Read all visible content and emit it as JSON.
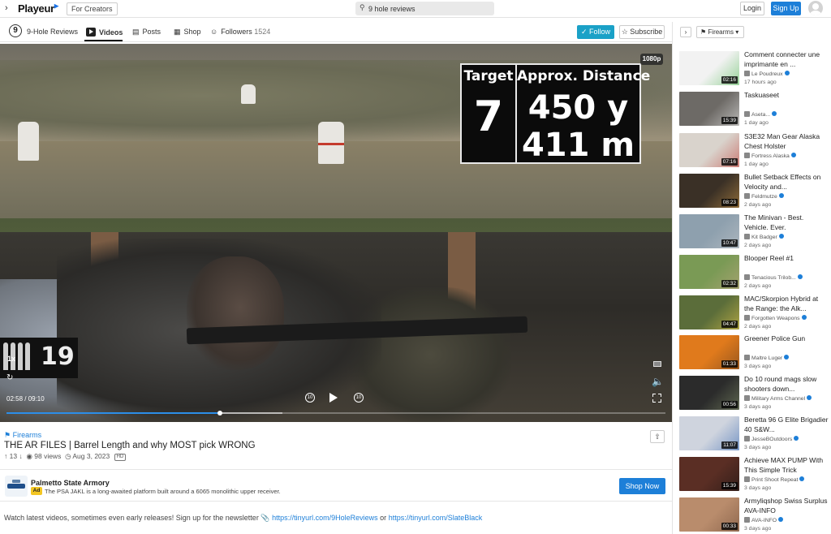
{
  "topbar": {
    "logo": "Playeur",
    "for_creators": "For Creators",
    "search_value": "9 hole reviews",
    "login": "Login",
    "signup": "Sign Up"
  },
  "channel": {
    "badge": "9",
    "name": "9-Hole Reviews",
    "tabs": [
      {
        "label": "Videos",
        "active": true
      },
      {
        "label": "Posts"
      },
      {
        "label": "Shop"
      },
      {
        "label": "Followers",
        "count": "1524"
      }
    ],
    "follow": "Follow",
    "subscribe": "Subscribe"
  },
  "player": {
    "quality": "1080p",
    "overlay": {
      "target_label": "Target",
      "target_value": "7",
      "distance_label": "Approx. Distance",
      "distance_yards": "450 y",
      "distance_meters": "411 m"
    },
    "ammo_count": "19",
    "speed": "1x",
    "time": "02:58 / 09:10",
    "rewind_label": "10",
    "forward_label": "10",
    "progress_fraction": 0.3236
  },
  "video": {
    "category": "Firearms",
    "title": "THE AR FILES | Barrel Length and why MOST pick WRONG",
    "votes": "13",
    "views": "98 views",
    "date": "Aug 3, 2023",
    "hd_badge": "HD"
  },
  "ad": {
    "advertiser": "Palmetto State Armory",
    "tag": "Ad",
    "text": "The PSA JAKL is a long-awaited platform built around a 6065 monolithic upper receiver.",
    "cta": "Shop Now"
  },
  "description": {
    "text": "Watch latest videos, sometimes even early releases! Sign up for the newsletter",
    "link1": "https://tinyurl.com/9HoleReviews",
    "or": "or",
    "link2": "https://tinyurl.com/SlateBlack"
  },
  "sidebar": {
    "filter": "Firearms",
    "videos": [
      {
        "title": "Comment connecter une imprimante en ...",
        "channel": "Le Poudreux",
        "age": "17 hours ago",
        "duration": "02:16",
        "thumb_color": "#f2f2f2",
        "thumb_accent": "#46b649"
      },
      {
        "title": "Taskuaseet",
        "channel": "Aseta...",
        "age": "1 day ago",
        "duration": "15:39",
        "thumb_color": "#6d6a66",
        "thumb_accent": "#ffffff"
      },
      {
        "title": "S3E32 Man Gear Alaska Chest Holster",
        "channel": "Fortress Alaska",
        "age": "1 day ago",
        "duration": "07:16",
        "thumb_color": "#d9d3cc",
        "thumb_accent": "#c0302a"
      },
      {
        "title": "Bullet Setback Effects on Velocity and...",
        "channel": "Feldmutze",
        "age": "2 days ago",
        "duration": "08:23",
        "thumb_color": "#3a3026",
        "thumb_accent": "#d9a04a"
      },
      {
        "title": "The Minivan - Best. Vehicle. Ever.",
        "channel": "Kit Badger",
        "age": "2 days ago",
        "duration": "10:47",
        "thumb_color": "#8ea0ae",
        "thumb_accent": "#c7c9cc"
      },
      {
        "title": "Blooper Reel #1",
        "channel": "Tenacious Trilob...",
        "age": "2 days ago",
        "duration": "02:32",
        "thumb_color": "#7a9a55",
        "thumb_accent": "#c9a986"
      },
      {
        "title": "MAC/Skorpion Hybrid at the Range: the Alk...",
        "channel": "Forgotten Weapons",
        "age": "2 days ago",
        "duration": "04:47",
        "thumb_color": "#5b6d3a",
        "thumb_accent": "#f6d34a"
      },
      {
        "title": "Greener Police Gun",
        "channel": "Maltre Luger",
        "age": "3 days ago",
        "duration": "01:33",
        "thumb_color": "#e07a1c",
        "thumb_accent": "#5b3a20"
      },
      {
        "title": "Do 10 round mags slow shooters down...",
        "channel": "Military Arms Channel",
        "age": "3 days ago",
        "duration": "00:56",
        "thumb_color": "#2b2b2b",
        "thumb_accent": "#8b9b70"
      },
      {
        "title": "Beretta 96 G Elite Brigadier 40 S&W...",
        "channel": "JesseBOutdoors",
        "age": "3 days ago",
        "duration": "11:07",
        "thumb_color": "#cfd4de",
        "thumb_accent": "#2a5fb0"
      },
      {
        "title": "Achieve MAX PUMP With This Simple Trick",
        "channel": "Print Shoot Repeat",
        "age": "3 days ago",
        "duration": "15:39",
        "thumb_color": "#5a2e24",
        "thumb_accent": "#111111"
      },
      {
        "title": "Armyliqshop Swiss Surplus AVA-INFO",
        "channel": "AVA-INFO",
        "age": "3 days ago",
        "duration": "00:33",
        "thumb_color": "#b98c6c",
        "thumb_accent": "#6b4a36"
      }
    ]
  }
}
